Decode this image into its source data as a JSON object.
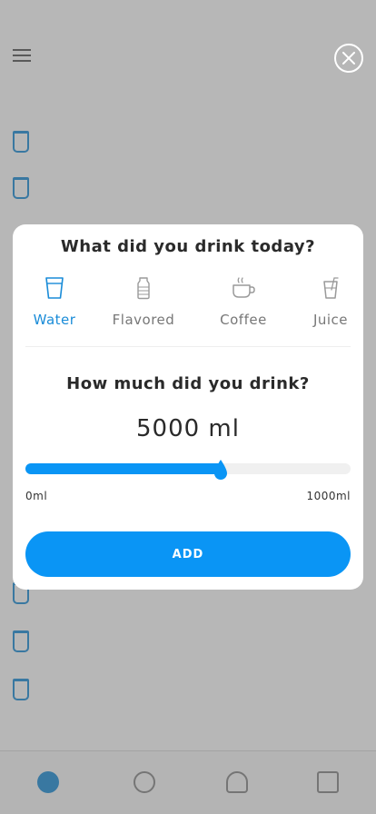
{
  "modal": {
    "title": "What did you drink today?",
    "drinks": [
      {
        "label": "Water",
        "icon": "water-glass-icon",
        "active": true
      },
      {
        "label": "Flavored",
        "icon": "flavored-bottle-icon",
        "active": false
      },
      {
        "label": "Coffee",
        "icon": "coffee-cup-icon",
        "active": false
      },
      {
        "label": "Juice",
        "icon": "juice-glass-icon",
        "active": false
      }
    ],
    "question": "How much did you drink?",
    "amount_display": "5000 ml",
    "slider": {
      "min_label": "0ml",
      "max_label": "1000ml",
      "fill_fraction": 0.6
    },
    "add_label": "ADD",
    "close_icon": "close-icon"
  },
  "colors": {
    "accent": "#0a95f5",
    "active_tab": "#1a8cd8",
    "track": "#f0f0f0",
    "overlay": "rgba(95,95,95,0.45)"
  }
}
